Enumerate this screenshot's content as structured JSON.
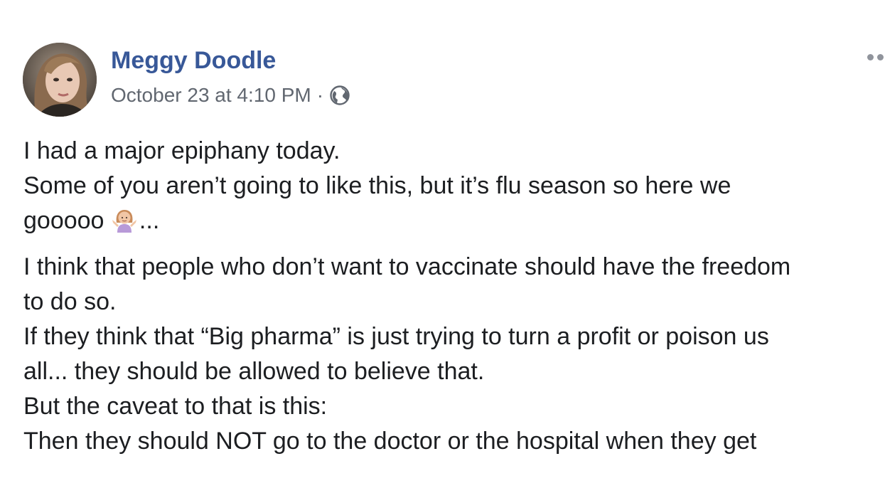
{
  "post": {
    "author": "Meggy Doodle",
    "timestamp": "October 23 at 4:10 PM",
    "separator": "·",
    "privacy_icon": "globe-icon",
    "more_icon": "more-options-icon",
    "lines": {
      "l1": "I had a major epiphany today.",
      "l2": "Some of you aren’t going to like this, but it’s flu season so here we",
      "l3_text": "gooooo",
      "l3_emoji": "woman-shrugging-emoji",
      "l3_tail": "...",
      "l4": "I think that people who don’t want to vaccinate should have the freedom",
      "l5": "to do so.",
      "l6": "If they think that “Big pharma” is just trying to turn a profit or poison us",
      "l7": "all... they should be allowed to believe that.",
      "l8": "But the caveat to that is this:",
      "l9": "Then they should NOT go to the doctor or the hospital when they get"
    }
  },
  "colors": {
    "author": "#385898",
    "meta": "#616770",
    "text": "#1c1e21"
  }
}
